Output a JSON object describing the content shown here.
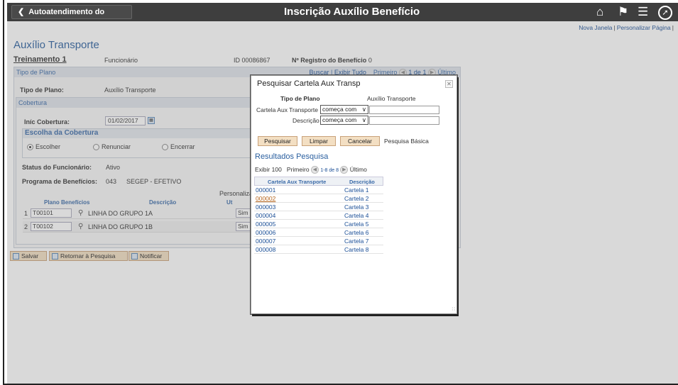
{
  "banner": {
    "back_label": "Autoatendimento do Gerente",
    "title": "Inscrição Auxílio Benefício",
    "icons": [
      "home-icon",
      "flag-icon",
      "menu-icon",
      "navbar-icon"
    ]
  },
  "top_links": {
    "new_window": "Nova Janela",
    "personalize": "Personalizar Página"
  },
  "page": {
    "title": "Auxílio Transporte",
    "employee_name": "Treinamento 1",
    "employee_role": "Funcionário",
    "id_label": "ID",
    "id_value": "00086867",
    "reg_label": "Nº Registro do Benefício",
    "reg_value": "0"
  },
  "plan_section": {
    "header": "Tipo de Plano",
    "search_link": "Buscar",
    "show_all_link": "Exibir Tudo",
    "first_label": "Primeiro",
    "range": "1 de 1",
    "last_label": "Último",
    "plan_type_label": "Tipo de Plano:",
    "plan_type_value": "Auxílio Transporte"
  },
  "coverage": {
    "header": "Cobertura",
    "start_label": "Iníc Cobertura:",
    "start_value": "01/02/2017",
    "choice_header": "Escolha da Cobertura",
    "options": [
      "Escolher",
      "Renunciar",
      "Encerrar"
    ],
    "selected": "Escolher",
    "status_label": "Status do Funcionário:",
    "status_value": "Ativo",
    "program_label": "Programa de Benefícios:",
    "program_code": "043",
    "program_name": "SEGEP - EFETIVO",
    "personalize": "Personaliza"
  },
  "benefits_grid": {
    "headers": [
      "Plano Benefícios",
      "Descrição",
      "Ut"
    ],
    "rows": [
      {
        "num": "1",
        "code": "T00101",
        "desc": "LINHA DO GRUPO 1A",
        "use": "Sim"
      },
      {
        "num": "2",
        "code": "T00102",
        "desc": "LINHA DO GRUPO 1B",
        "use": "Sim"
      }
    ]
  },
  "actions": {
    "save": "Salvar",
    "return": "Retornar à Pesquisa",
    "notify": "Notificar"
  },
  "modal": {
    "title": "Pesquisar Cartela Aux Transp",
    "plan_type_label": "Tipo de Plano",
    "plan_type_value": "Auxílio Transporte",
    "card_label": "Cartela Aux Transporte",
    "desc_label": "Descrição",
    "operator": "começa com",
    "search_btn": "Pesquisar",
    "clear_btn": "Limpar",
    "cancel_btn": "Cancelar",
    "basic_link": "Pesquisa Básica",
    "results_title": "Resultados Pesquisa",
    "show_label": "Exibir 100",
    "first_label": "Primeiro",
    "range": "1-8 de 8",
    "last_label": "Último",
    "col1": "Cartela Aux Transporte",
    "col2": "Descrição",
    "results": [
      {
        "code": "000001",
        "desc": "Cartela 1"
      },
      {
        "code": "000002",
        "desc": "Cartela 2"
      },
      {
        "code": "000003",
        "desc": "Cartela 3"
      },
      {
        "code": "000004",
        "desc": "Cartela 4"
      },
      {
        "code": "000005",
        "desc": "Cartela 5"
      },
      {
        "code": "000006",
        "desc": "Cartela 6"
      },
      {
        "code": "000007",
        "desc": "Cartela 7"
      },
      {
        "code": "000008",
        "desc": "Cartela 8"
      }
    ]
  }
}
